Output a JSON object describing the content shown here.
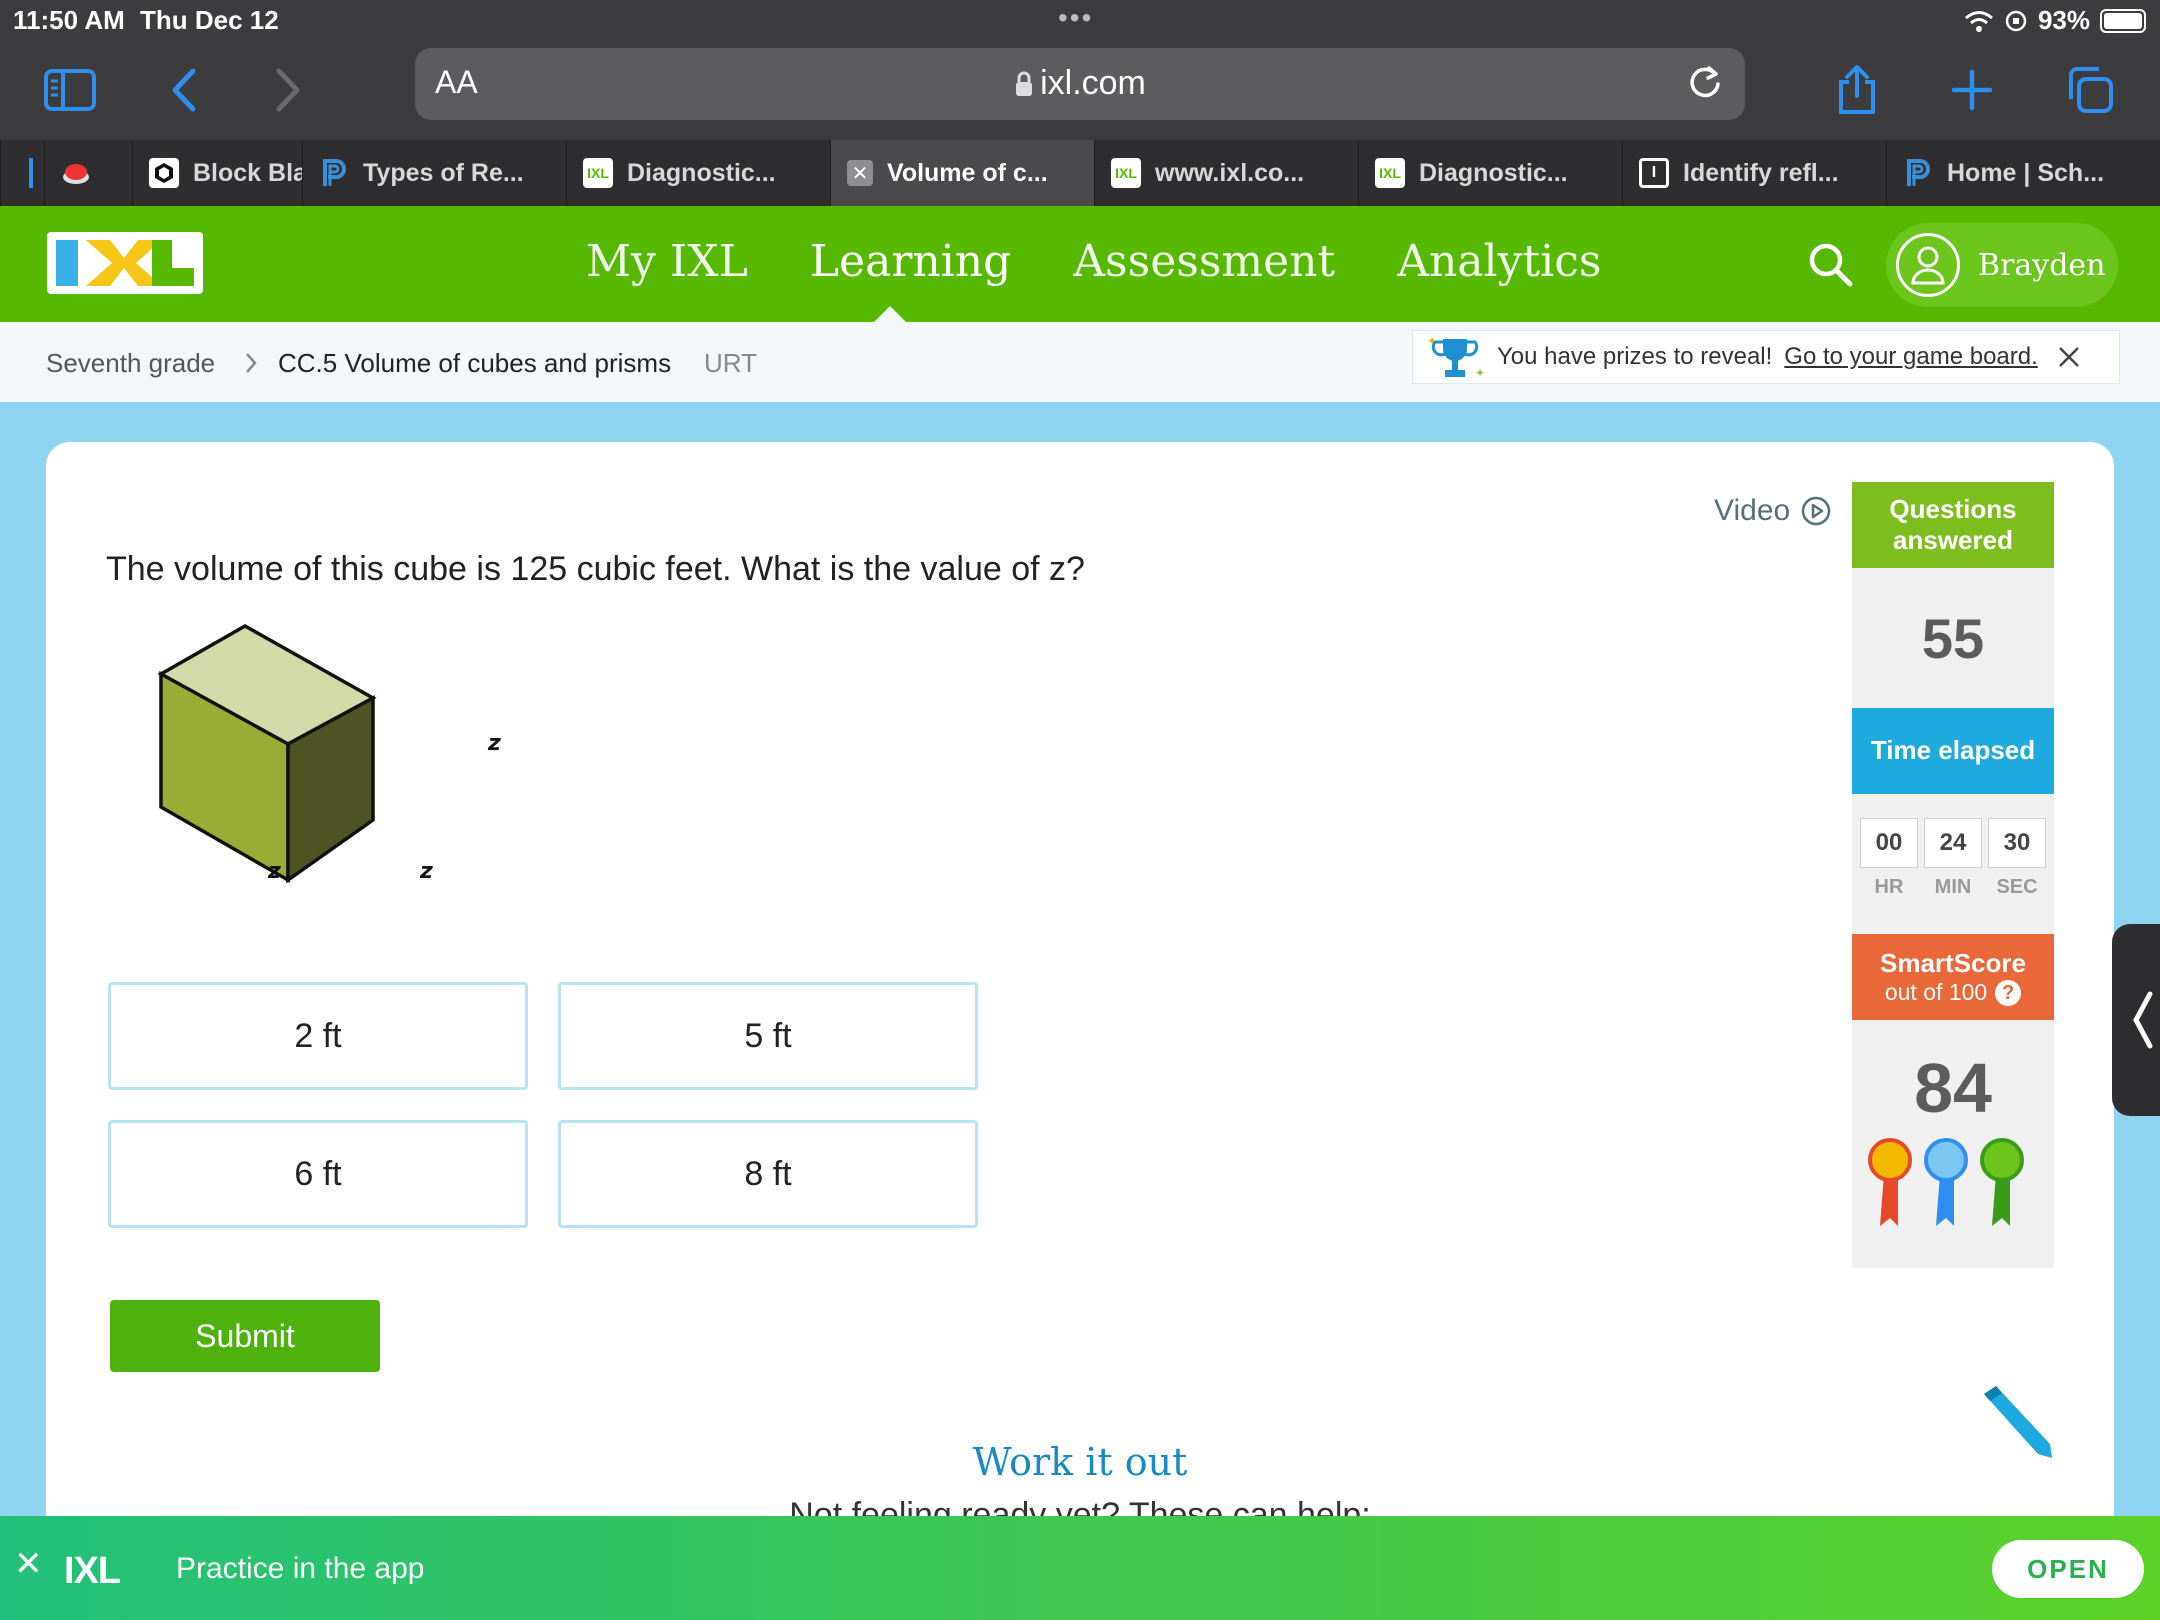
{
  "status": {
    "time": "11:50 AM",
    "date": "Thu Dec 12",
    "battery": "93%"
  },
  "browser": {
    "url_size_label": "AA",
    "url": "ixl.com",
    "tabs": [
      {
        "label": "",
        "favicon": "blue-bar"
      },
      {
        "label": "",
        "favicon": "red-button"
      },
      {
        "label": "Block Bla",
        "favicon": "cube"
      },
      {
        "label": "Types of Re...",
        "favicon": "p-logo"
      },
      {
        "label": "Diagnostic...",
        "favicon": "ixl"
      },
      {
        "label": "Volume of c...",
        "favicon": "close",
        "active": true
      },
      {
        "label": "www.ixl.co...",
        "favicon": "ixl"
      },
      {
        "label": "Diagnostic...",
        "favicon": "ixl"
      },
      {
        "label": "Identify refl...",
        "favicon": "i-box"
      },
      {
        "label": "Home | Sch...",
        "favicon": "p-logo"
      }
    ]
  },
  "header": {
    "logo": "IXL",
    "nav": [
      "My IXL",
      "Learning",
      "Assessment",
      "Analytics"
    ],
    "active_nav": "Learning",
    "user_name": "Brayden"
  },
  "breadcrumb": {
    "grade": "Seventh grade",
    "skill": "CC.5 Volume of cubes and prisms",
    "code": "URT"
  },
  "prize_banner": {
    "text": "You have prizes to reveal!",
    "link": "Go to your game board."
  },
  "question": {
    "text": "The volume of this cube is 125 cubic feet. What is the value of z?",
    "video_label": "Video",
    "cube_labels": [
      "z",
      "z",
      "z"
    ],
    "choices": [
      "2 ft",
      "5 ft",
      "6 ft",
      "8 ft"
    ],
    "submit_label": "Submit",
    "work_title": "Work it out",
    "work_sub": "Not feeling ready yet? These can help:"
  },
  "stats": {
    "questions_label": "Questions answered",
    "questions_value": "55",
    "time_label": "Time elapsed",
    "hr": "00",
    "min": "24",
    "sec": "30",
    "hr_label": "HR",
    "min_label": "MIN",
    "sec_label": "SEC",
    "smartscore_label": "SmartScore",
    "smartscore_sub": "out of 100",
    "smartscore_value": "84",
    "colors": {
      "questions": "#7dbd1d",
      "time": "#1ea9df",
      "smartscore": "#e8683a"
    }
  },
  "app_banner": {
    "logo": "IXL",
    "text": "Practice in the app",
    "open_label": "OPEN"
  }
}
